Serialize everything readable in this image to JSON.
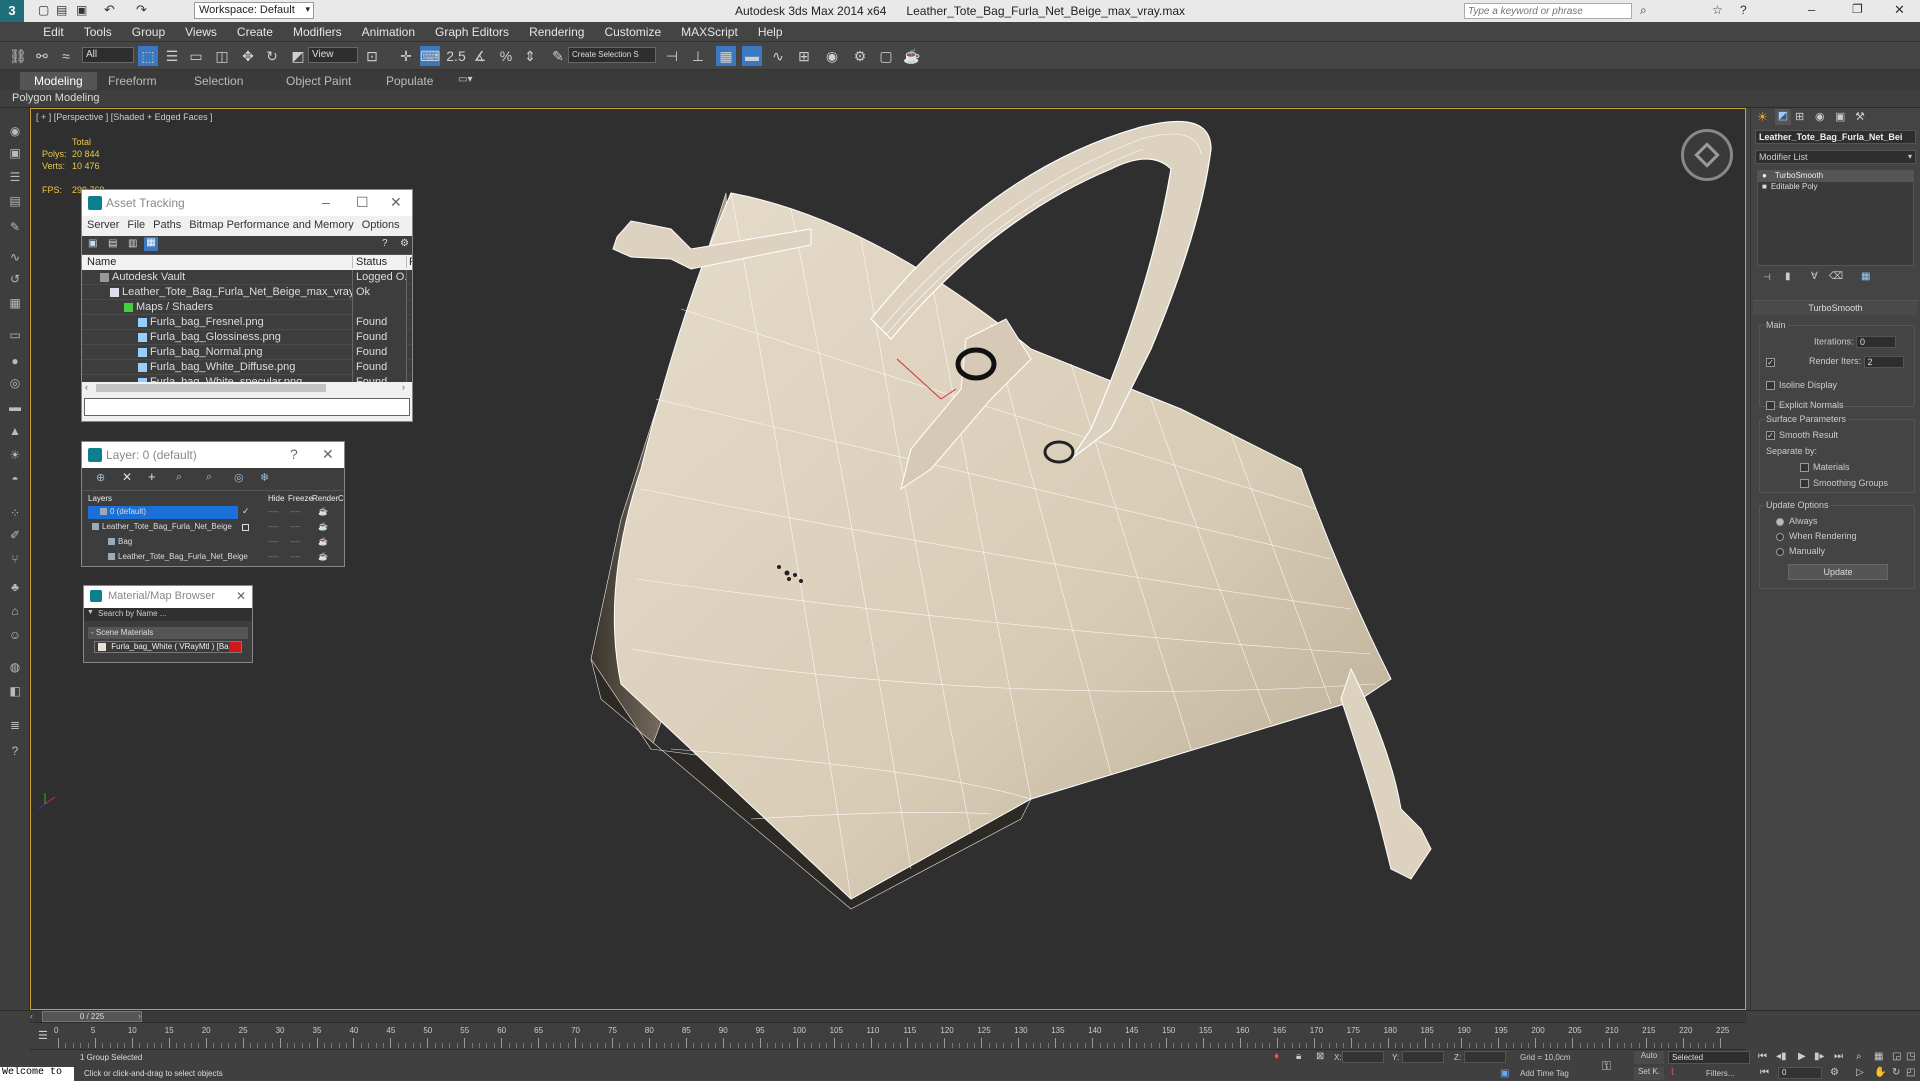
{
  "title_bar": {
    "workspace": "Workspace: Default",
    "app": "Autodesk 3ds Max  2014 x64",
    "file": "Leather_Tote_Bag_Furla_Net_Beige_max_vray.max",
    "search_placeholder": "Type a keyword or phrase"
  },
  "menu": [
    "Edit",
    "Tools",
    "Group",
    "Views",
    "Create",
    "Modifiers",
    "Animation",
    "Graph Editors",
    "Rendering",
    "Customize",
    "MAXScript",
    "Help"
  ],
  "toolbar": {
    "selection_filter": "All",
    "ref_coord": "View",
    "named_sel": "Create Selection S"
  },
  "ribbon": {
    "tabs": [
      "Modeling",
      "Freeform",
      "Selection",
      "Object Paint",
      "Populate"
    ],
    "sub": "Polygon Modeling"
  },
  "viewport": {
    "label": "[ + ] [Perspective ] [Shaded + Edged Faces ]",
    "stats": {
      "total": "Total",
      "polys_label": "Polys:",
      "polys": "20 844",
      "verts_label": "Verts:",
      "verts": "10 476",
      "fps_label": "FPS:",
      "fps": "299,769"
    }
  },
  "asset_tracking": {
    "title": "Asset Tracking",
    "menu": [
      "Server",
      "File",
      "Paths",
      "Bitmap Performance and Memory",
      "Options"
    ],
    "col_name": "Name",
    "col_status": "Status",
    "col_extra": "F",
    "rows": [
      {
        "name": "Autodesk Vault",
        "status": "Logged O..."
      },
      {
        "name": "Leather_Tote_Bag_Furla_Net_Beige_max_vray.max",
        "status": "Ok"
      },
      {
        "name": "Maps / Shaders",
        "status": ""
      },
      {
        "name": "Furla_bag_Fresnel.png",
        "status": "Found"
      },
      {
        "name": "Furla_bag_Glossiness.png",
        "status": "Found"
      },
      {
        "name": "Furla_bag_Normal.png",
        "status": "Found"
      },
      {
        "name": "Furla_bag_White_Diffuse.png",
        "status": "Found"
      },
      {
        "name": "Furla_bag_White_specular.png",
        "status": "Found"
      }
    ]
  },
  "layer": {
    "title": "Layer: 0 (default)",
    "help": "?",
    "cols": [
      "Layers",
      "Hide",
      "Freeze",
      "Render",
      "C"
    ],
    "rows": [
      {
        "name": "0 (default)"
      },
      {
        "name": "Leather_Tote_Bag_Furla_Net_Beige"
      },
      {
        "name": "Bag"
      },
      {
        "name": "Leather_Tote_Bag_Furla_Net_Beige"
      }
    ],
    "dash": "----"
  },
  "material_browser": {
    "title": "Material/Map Browser",
    "search": "Search by Name ...",
    "section": "- Scene Materials",
    "item": "Furla_bag_White  ( VRayMtl ) [Bag]"
  },
  "command_panel": {
    "object_name": "Leather_Tote_Bag_Furla_Net_Bei",
    "modifier_list": "Modifier List",
    "stack": [
      "TurboSmooth",
      "Editable Poly"
    ],
    "rollout": "TurboSmooth",
    "main": "Main",
    "iterations_label": "Iterations:",
    "iterations": "0",
    "render_iters_label": "Render Iters:",
    "render_iters": "2",
    "isoline": "Isoline Display",
    "explicit": "Explicit Normals",
    "surface": "Surface Parameters",
    "smooth_result": "Smooth Result",
    "separate_by": "Separate by:",
    "materials": "Materials",
    "smoothing_groups": "Smoothing Groups",
    "update_options": "Update Options",
    "always": "Always",
    "when_rendering": "When Rendering",
    "manually": "Manually",
    "update_btn": "Update"
  },
  "timeline": {
    "frame": "0 / 225",
    "ticks": [
      "0",
      "5",
      "10",
      "15",
      "20",
      "25",
      "30",
      "35",
      "40",
      "45",
      "50",
      "55",
      "60",
      "65",
      "70",
      "75",
      "80",
      "85",
      "90",
      "95",
      "100",
      "105",
      "110",
      "115",
      "120",
      "125",
      "130",
      "135",
      "140",
      "145",
      "150",
      "155",
      "160",
      "165",
      "170",
      "175",
      "180",
      "185",
      "190",
      "195",
      "200",
      "205",
      "210",
      "215",
      "220",
      "225"
    ]
  },
  "status": {
    "welcome": "Welcome to",
    "selected": "1 Group Selected",
    "hint": "Click or click-and-drag to select objects",
    "x_label": "X:",
    "y_label": "Y:",
    "z_label": "Z:",
    "grid": "Grid = 10,0cm",
    "add_time_tag": "Add Time Tag",
    "auto": "Auto",
    "set_key": "Set K.",
    "selected_dd": "Selected",
    "filters": "Filters...",
    "frame_field": "0"
  }
}
